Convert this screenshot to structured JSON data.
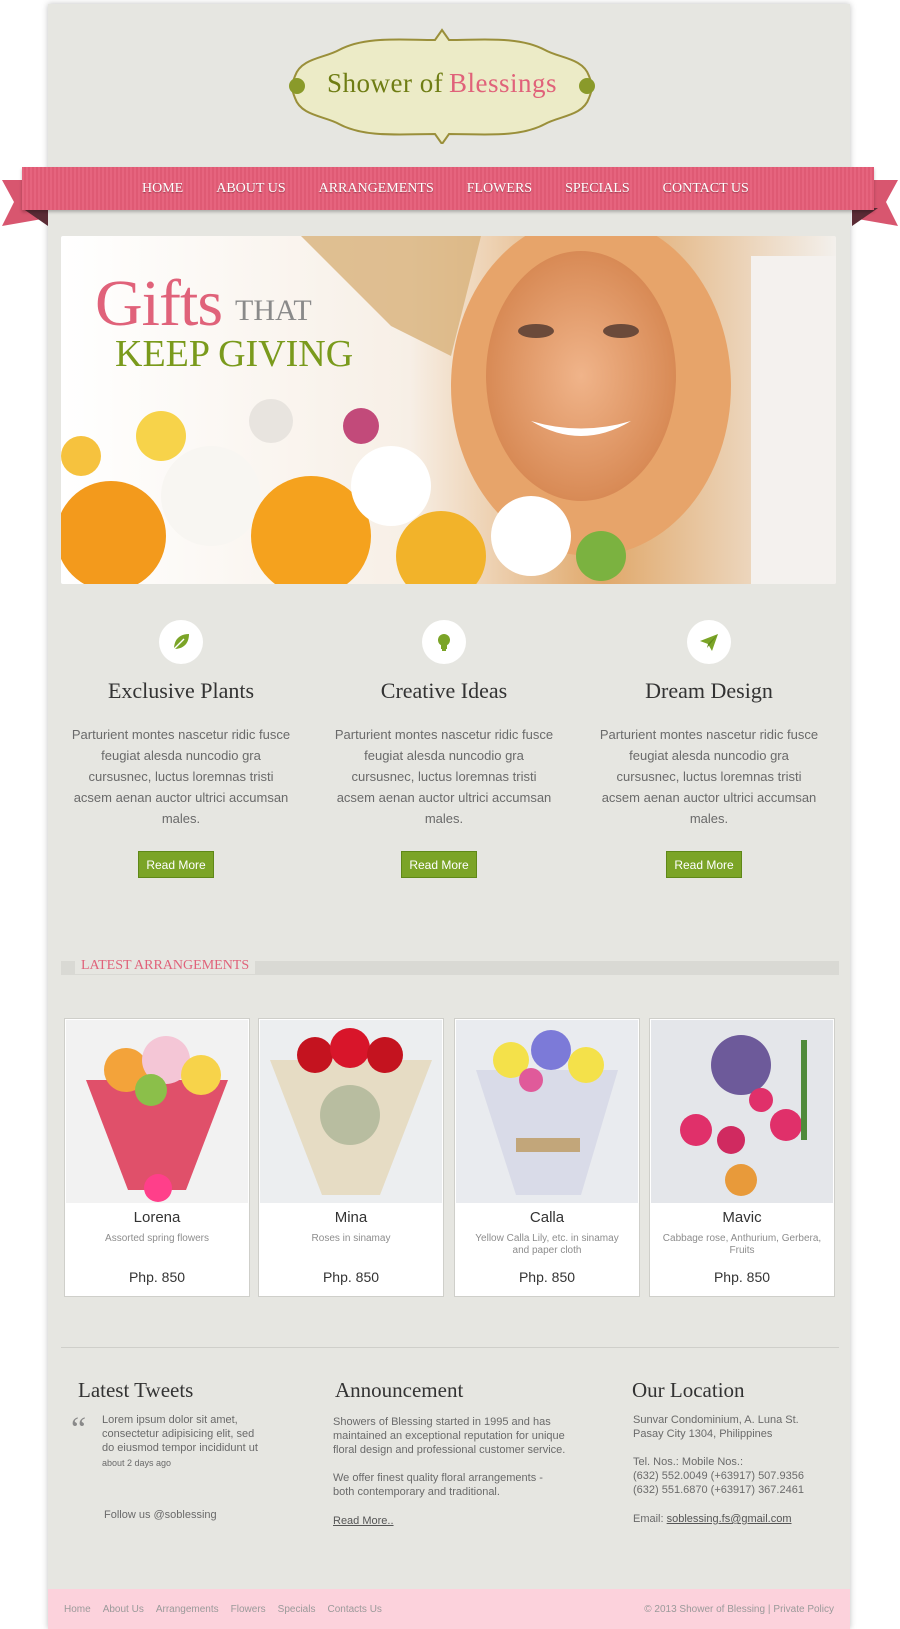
{
  "logo": {
    "text_first": "Shower of",
    "text_second": "Blessings"
  },
  "nav": {
    "items": [
      {
        "label": "HOME"
      },
      {
        "label": "ABOUT US"
      },
      {
        "label": "ARRANGEMENTS"
      },
      {
        "label": "FLOWERS"
      },
      {
        "label": "SPECIALS"
      },
      {
        "label": "CONTACT US"
      }
    ]
  },
  "hero": {
    "title": "Gifts",
    "title_small": "THAT",
    "subtitle": "KEEP GIVING"
  },
  "features": [
    {
      "icon": "leaf-icon",
      "title": "Exclusive Plants",
      "text": "Parturient  montes nascetur ridic fusce feugiat alesda nuncodio gra cursusnec, luctus loremnas tristi acsem aenan auctor ultrici accumsan males.",
      "button": "Read More"
    },
    {
      "icon": "lightbulb-icon",
      "title": "Creative Ideas",
      "text": "Parturient  montes nascetur ridic fusce feugiat alesda nuncodio gra cursusnec, luctus loremnas tristi acsem aenan auctor ultrici accumsan males.",
      "button": "Read More"
    },
    {
      "icon": "paper-plane-icon",
      "title": "Dream Design",
      "text": "Parturient  montes nascetur ridic fusce feugiat alesda nuncodio gra cursusnec, luctus loremnas tristi acsem aenan auctor ultrici accumsan males.",
      "button": "Read More"
    }
  ],
  "latest": {
    "heading": "LATEST ARRANGEMENTS",
    "products": [
      {
        "name": "Lorena",
        "desc": "Assorted spring flowers",
        "price": "Php. 850"
      },
      {
        "name": "Mina",
        "desc": "Roses in sinamay",
        "price": "Php. 850"
      },
      {
        "name": "Calla",
        "desc": "Yellow Calla Lily, etc. in sinamay and paper cloth",
        "price": "Php. 850"
      },
      {
        "name": "Mavic",
        "desc": "Cabbage rose, Anthurium, Gerbera, Fruits",
        "price": "Php. 850"
      }
    ]
  },
  "tweets": {
    "title": "Latest Tweets",
    "line1": "Lorem ipsum dolor sit amet,",
    "line2": "consectetur adipisicing elit, sed",
    "line3": "do eiusmod tempor incididunt ut",
    "time": "about 2 days ago",
    "follow": "Follow us @soblessing"
  },
  "announcement": {
    "title": "Announcement",
    "p1_line1": "Showers of Blessing started in 1995 and has",
    "p1_line2": "maintained an exceptional reputation for unique",
    "p1_line3": "floral design and professional customer service.",
    "p2_line1": "We offer finest quality floral arrangements -",
    "p2_line2": "both contemporary and traditional.",
    "link": "Read More.."
  },
  "location": {
    "title": "Our Location",
    "addr1": "Sunvar Condominium, A. Luna St.",
    "addr2": "Pasay City 1304, Philippines",
    "tel_label": "Tel. Nos.: Mobile Nos.:",
    "tel1": "(632) 552.0049 (+63917) 507.9356",
    "tel2": "(632) 551.6870 (+63917) 367.2461",
    "email_label": "Email:",
    "email": "soblessing.fs@gmail.com"
  },
  "footer": {
    "links": [
      {
        "label": "Home"
      },
      {
        "label": "About Us"
      },
      {
        "label": "Arrangements"
      },
      {
        "label": "Flowers"
      },
      {
        "label": "Specials"
      },
      {
        "label": "Contacts Us"
      }
    ],
    "copyright": "© 2013 Shower of Blessing |",
    "privacy": "Private Policy"
  },
  "colors": {
    "accent_pink": "#e0627a",
    "accent_green": "#7ba427",
    "background": "#e6e6e1",
    "footer": "#fcd2dc"
  }
}
